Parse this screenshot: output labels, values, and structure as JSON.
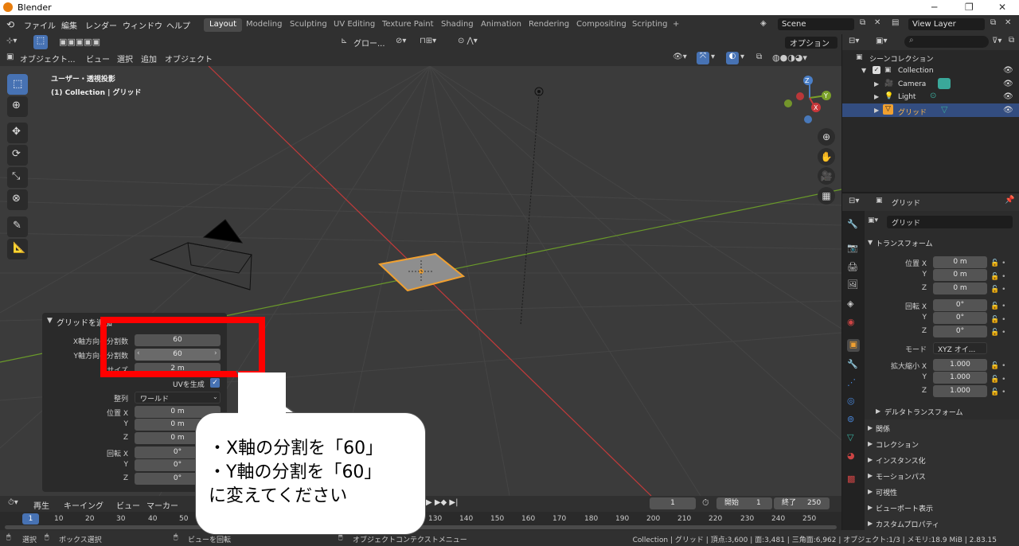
{
  "window": {
    "title": "Blender",
    "controls": [
      "─",
      "❐",
      "✕"
    ]
  },
  "menubar": {
    "menus": [
      "ファイル",
      "編集",
      "レンダー",
      "ウィンドウ",
      "ヘルプ"
    ],
    "workspaces": [
      "Layout",
      "Modeling",
      "Sculpting",
      "UV Editing",
      "Texture Paint",
      "Shading",
      "Animation",
      "Rendering",
      "Compositing",
      "Scripting"
    ],
    "active_workspace": "Layout",
    "add_tab": "+",
    "scene": "Scene",
    "view_layer": "View Layer"
  },
  "viewport": {
    "header1": {
      "transform_orientation": "グロー...",
      "options": "オプション"
    },
    "header2": {
      "mode": "オブジェクト...",
      "menus": [
        "ビュー",
        "選択",
        "追加",
        "オブジェクト"
      ]
    },
    "overlay_title": "ユーザー・透視投影",
    "overlay_subtitle": "(1) Collection | グリッド",
    "gizmo": {
      "x": "X",
      "y": "Y",
      "z": "Z"
    }
  },
  "operator_panel": {
    "title": "グリッドを追加",
    "rows": [
      {
        "label": "X軸方向の分割数",
        "value": "60"
      },
      {
        "label": "Y軸方向の分割数",
        "value": "60"
      },
      {
        "label": "サイズ",
        "value": "2 m"
      }
    ],
    "uv_label": "UVを生成",
    "uv_checked": true,
    "align_label": "整列",
    "align_value": "ワールド",
    "location_label": "位置 X",
    "location": [
      "0 m",
      "0 m",
      "0 m"
    ],
    "rotation_label": "回転 X",
    "rotation": [
      "0°",
      "0°",
      "0°"
    ],
    "axis_y": "Y",
    "axis_z": "Z"
  },
  "outliner": {
    "root": "シーンコレクション",
    "items": [
      {
        "name": "Collection"
      },
      {
        "name": "Camera"
      },
      {
        "name": "Light"
      },
      {
        "name": "グリッド",
        "selected": true
      }
    ]
  },
  "properties": {
    "header_name": "グリッド",
    "object_name": "グリッド",
    "transform_title": "トランスフォーム",
    "location_label": "位置 X",
    "location": [
      "0 m",
      "0 m",
      "0 m"
    ],
    "rotation_label": "回転 X",
    "rotation": [
      "0°",
      "0°",
      "0°"
    ],
    "mode_label": "モード",
    "mode_value": "XYZ オイ...",
    "scale_label": "拡大縮小 X",
    "scale": [
      "1.000",
      "1.000",
      "1.000"
    ],
    "axis_y": "Y",
    "axis_z": "Z",
    "delta": "デルタトランスフォーム",
    "sections": [
      "関係",
      "コレクション",
      "インスタンス化",
      "モーションパス",
      "可視性",
      "ビューポート表示",
      "カスタムプロパティ"
    ]
  },
  "timeline": {
    "menus": [
      "再生",
      "キーイング",
      "ビュー",
      "マーカー"
    ],
    "current_frame": "1",
    "start_label": "開始",
    "start": "1",
    "end_label": "終了",
    "end": "250",
    "ticks": [
      "1",
      "10",
      "20",
      "30",
      "40",
      "50",
      "130",
      "140",
      "150",
      "160",
      "170",
      "180",
      "190",
      "200",
      "210",
      "220",
      "230",
      "240",
      "250"
    ]
  },
  "statusbar": {
    "select": "選択",
    "box_select": "ボックス選択",
    "rotate_view": "ビューを回転",
    "context_menu": "オブジェクトコンテクストメニュー",
    "stats": "Collection | グリッド | 頂点:3,600 | 面:3,481 | 三角面:6,962 | オブジェクト:1/3 | メモリ:18.9 MiB | 2.83.15"
  },
  "annotation": {
    "lines": [
      "・X軸の分割を「60」",
      "・Y軸の分割を「60」",
      "に変えてください"
    ],
    "color": "#ff0000"
  },
  "colors": {
    "accent": "#4772b3",
    "selection": "#f0a030",
    "x_axis": "#c23a3a",
    "y_axis": "#6a9a2a"
  }
}
